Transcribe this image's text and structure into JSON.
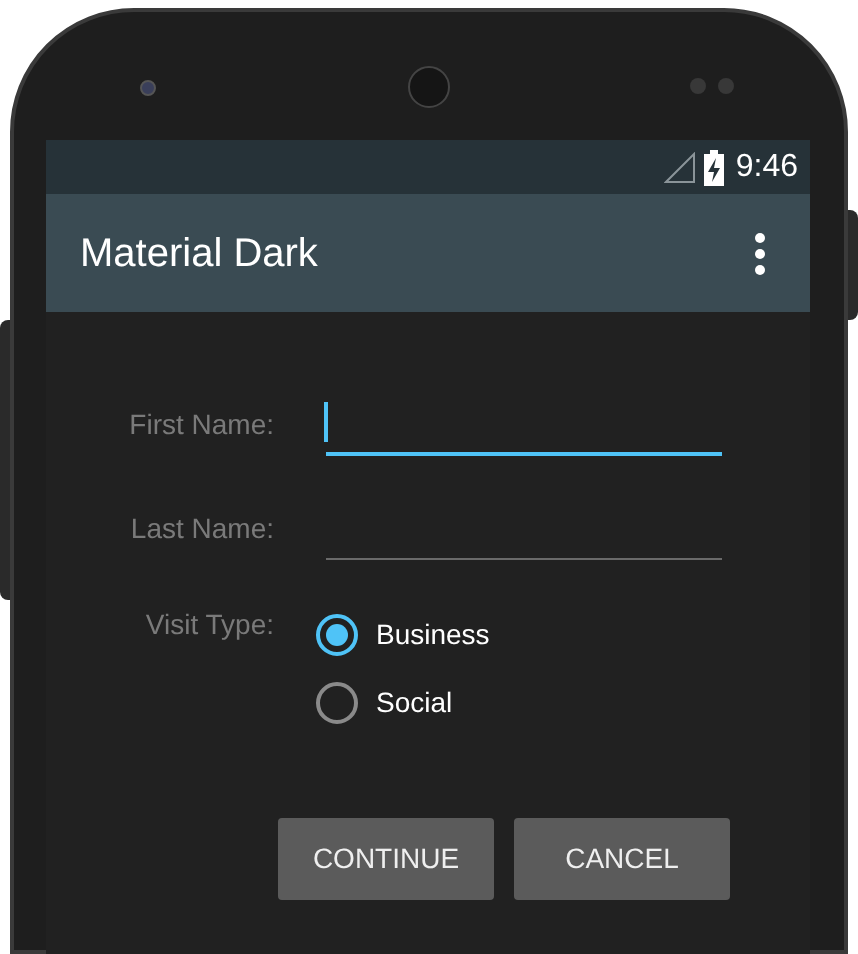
{
  "status_bar": {
    "time": "9:46"
  },
  "app_bar": {
    "title": "Material Dark"
  },
  "fields": [
    {
      "label": "First Name:",
      "focused": true
    },
    {
      "label": "Last Name:",
      "focused": false
    }
  ],
  "visit_type": {
    "label": "Visit Type:",
    "options": [
      {
        "label": "Business",
        "selected": true
      },
      {
        "label": "Social",
        "selected": false
      }
    ]
  },
  "buttons": [
    "CONTINUE",
    "CANCEL"
  ]
}
